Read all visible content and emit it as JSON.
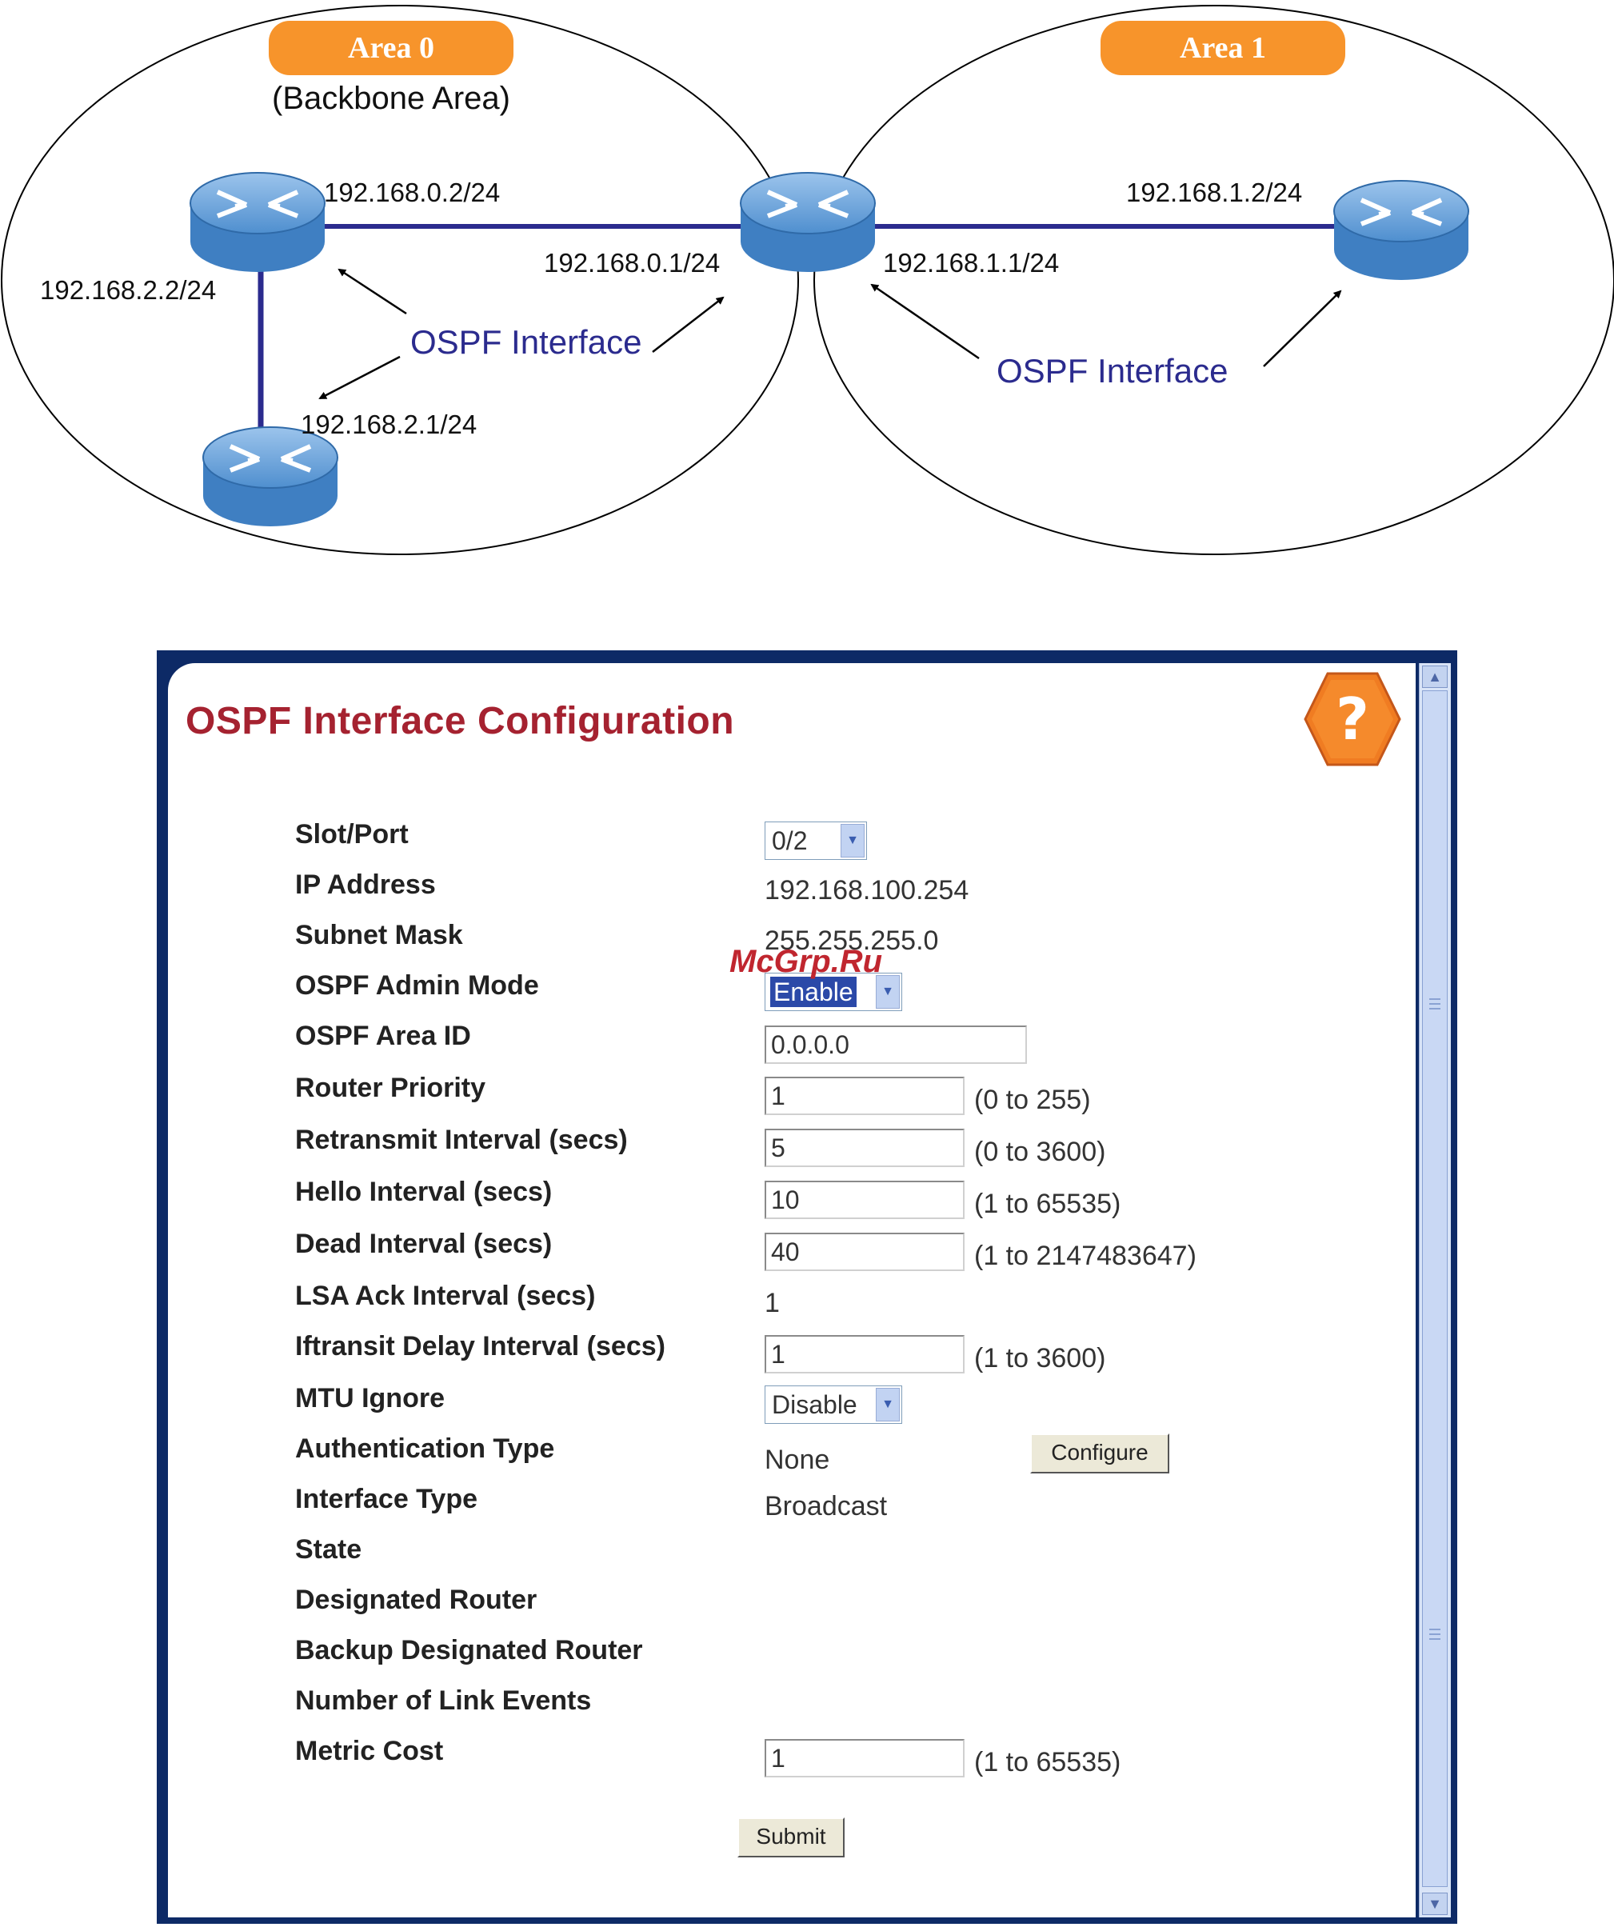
{
  "diagram": {
    "area0": {
      "title": "Area 0",
      "subtitle": "(Backbone Area)"
    },
    "area1": {
      "title": "Area 1"
    },
    "ips": {
      "r1_right": "192.168.0.2/24",
      "r1_bottom": "192.168.2.2/24",
      "r3_top": "192.168.2.1/24",
      "abr_left": "192.168.0.1/24",
      "abr_right": "192.168.1.1/24",
      "r4_left": "192.168.1.2/24"
    },
    "ospf_label_left": "OSPF Interface",
    "ospf_label_right": "OSPF Interface",
    "colors": {
      "badge": "#f7942b",
      "link": "#2b2b8e",
      "router": "#6fa6dc"
    }
  },
  "panel": {
    "title": "OSPF Interface Configuration",
    "help_icon": "question-mark",
    "watermark": "McGrp.Ru",
    "fields": {
      "slot_port": {
        "label": "Slot/Port",
        "value": "0/2"
      },
      "ip_address": {
        "label": "IP Address",
        "value": "192.168.100.254"
      },
      "subnet_mask": {
        "label": "Subnet Mask",
        "value": "255.255.255.0"
      },
      "admin_mode": {
        "label": "OSPF Admin Mode",
        "value": "Enable"
      },
      "area_id": {
        "label": "OSPF Area ID",
        "value": "0.0.0.0"
      },
      "router_priority": {
        "label": "Router Priority",
        "value": "1",
        "range": "(0 to 255)"
      },
      "retransmit": {
        "label": "Retransmit Interval (secs)",
        "value": "5",
        "range": "(0 to 3600)"
      },
      "hello": {
        "label": "Hello Interval (secs)",
        "value": "10",
        "range": "(1 to 65535)"
      },
      "dead": {
        "label": "Dead Interval (secs)",
        "value": "40",
        "range": "(1 to 2147483647)"
      },
      "lsa_ack": {
        "label": "LSA Ack Interval (secs)",
        "value": "1"
      },
      "iftransit": {
        "label": "Iftransit Delay Interval (secs)",
        "value": "1",
        "range": "(1 to 3600)"
      },
      "mtu_ignore": {
        "label": "MTU Ignore",
        "value": "Disable"
      },
      "auth_type": {
        "label": "Authentication Type",
        "value": "None",
        "button": "Configure"
      },
      "interface_type": {
        "label": "Interface Type",
        "value": "Broadcast"
      },
      "state": {
        "label": "State"
      },
      "dr": {
        "label": "Designated Router"
      },
      "bdr": {
        "label": "Backup Designated Router"
      },
      "link_events": {
        "label": "Number of Link Events"
      },
      "metric_cost": {
        "label": "Metric Cost",
        "value": "1",
        "range": "(1 to 65535)"
      }
    },
    "submit_label": "Submit",
    "colors": {
      "frame": "#0d2a66",
      "title": "#a52230",
      "help": "#f07c22"
    }
  }
}
